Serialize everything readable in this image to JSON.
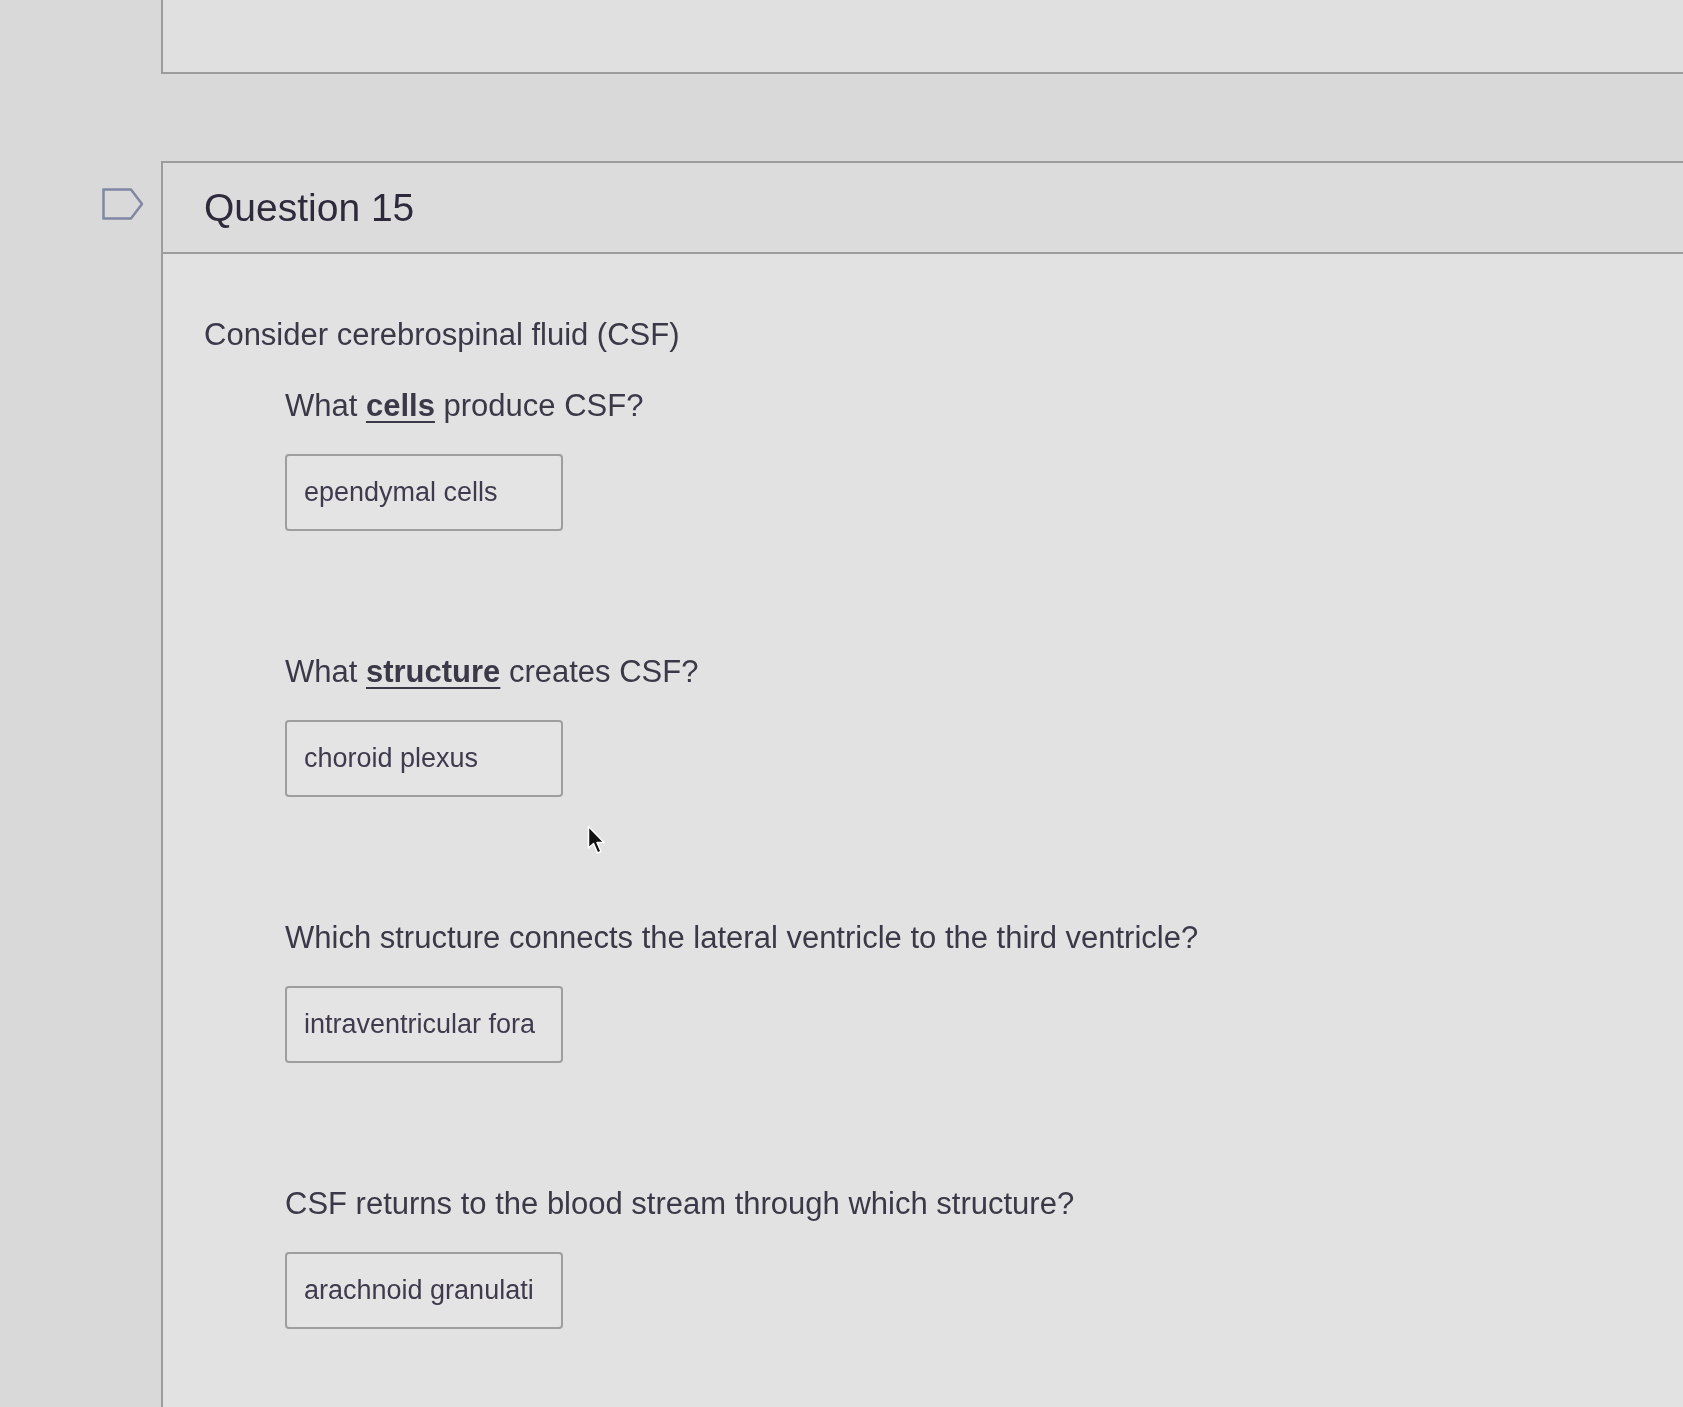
{
  "question": {
    "title": "Question 15",
    "flagged": false,
    "intro": "Consider cerebrospinal fluid (CSF)",
    "parts": [
      {
        "prompt": "What **cells** produce CSF?",
        "answer": "ependymal cells"
      },
      {
        "prompt": "What **structure** creates CSF?",
        "answer": "choroid plexus"
      },
      {
        "prompt": "Which structure connects the lateral ventricle to the third ventricle?",
        "answer": "intraventricular fora"
      },
      {
        "prompt": "CSF returns to the blood stream through which structure?",
        "answer": "arachnoid granulati"
      }
    ]
  }
}
